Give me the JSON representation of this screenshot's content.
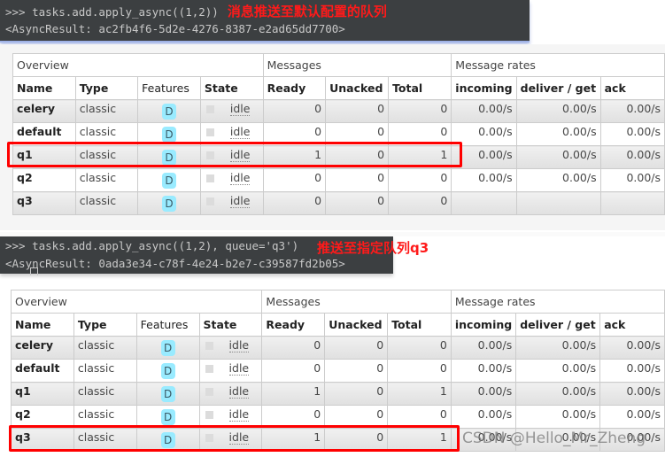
{
  "terminal1": {
    "command": ">>> tasks.add.apply_async((1,2))",
    "annotation": "消息推送至默认配置的队列",
    "result": "<AsyncResult: ac2fb4f6-5d2e-4276-8387-e2ad65dd7700>"
  },
  "terminal2": {
    "command": ">>> tasks.add.apply_async((1,2), queue='q3')",
    "annotation": "推送至指定队列q3",
    "result": "<AsyncResult: 0ada3e34-c78f-4e24-b2e7-c39587fd2b05>"
  },
  "table_headers": {
    "groups": [
      "Overview",
      "Messages",
      "Message rates"
    ],
    "columns": [
      "Name",
      "Type",
      "Features",
      "State",
      "Ready",
      "Unacked",
      "Total",
      "incoming",
      "deliver / get",
      "ack"
    ]
  },
  "table1": {
    "rows": [
      {
        "name": "celery",
        "type": "classic",
        "feature": "D",
        "state": "idle",
        "ready": "0",
        "unacked": "0",
        "total": "0",
        "incoming": "0.00/s",
        "deliver": "0.00/s",
        "ack": "0.00/s"
      },
      {
        "name": "default",
        "type": "classic",
        "feature": "D",
        "state": "idle",
        "ready": "0",
        "unacked": "0",
        "total": "0",
        "incoming": "0.00/s",
        "deliver": "0.00/s",
        "ack": "0.00/s"
      },
      {
        "name": "q1",
        "type": "classic",
        "feature": "D",
        "state": "idle",
        "ready": "1",
        "unacked": "0",
        "total": "1",
        "incoming": "0.00/s",
        "deliver": "0.00/s",
        "ack": "0.00/s"
      },
      {
        "name": "q2",
        "type": "classic",
        "feature": "D",
        "state": "idle",
        "ready": "0",
        "unacked": "0",
        "total": "0",
        "incoming": "0.00/s",
        "deliver": "0.00/s",
        "ack": "0.00/s"
      },
      {
        "name": "q3",
        "type": "classic",
        "feature": "D",
        "state": "idle",
        "ready": "0",
        "unacked": "0",
        "total": "0",
        "incoming": "",
        "deliver": "",
        "ack": ""
      }
    ]
  },
  "table2": {
    "rows": [
      {
        "name": "celery",
        "type": "classic",
        "feature": "D",
        "state": "idle",
        "ready": "0",
        "unacked": "0",
        "total": "0",
        "incoming": "0.00/s",
        "deliver": "0.00/s",
        "ack": "0.00/s"
      },
      {
        "name": "default",
        "type": "classic",
        "feature": "D",
        "state": "idle",
        "ready": "0",
        "unacked": "0",
        "total": "0",
        "incoming": "0.00/s",
        "deliver": "0.00/s",
        "ack": "0.00/s"
      },
      {
        "name": "q1",
        "type": "classic",
        "feature": "D",
        "state": "idle",
        "ready": "1",
        "unacked": "0",
        "total": "1",
        "incoming": "0.00/s",
        "deliver": "0.00/s",
        "ack": "0.00/s"
      },
      {
        "name": "q2",
        "type": "classic",
        "feature": "D",
        "state": "idle",
        "ready": "0",
        "unacked": "0",
        "total": "0",
        "incoming": "0.00/s",
        "deliver": "0.00/s",
        "ack": "0.00/s"
      },
      {
        "name": "q3",
        "type": "classic",
        "feature": "D",
        "state": "idle",
        "ready": "1",
        "unacked": "0",
        "total": "1",
        "incoming": "0.00/s",
        "deliver": "0.00/s",
        "ack": "0.00/s"
      }
    ]
  },
  "watermark": "CSDN @Hello_Mr_Zheng",
  "colors": {
    "highlight": "#ff0000",
    "annotation": "#ff1a1a",
    "terminal_bg": "#3c3f41",
    "feature_badge": "#99ebff"
  }
}
